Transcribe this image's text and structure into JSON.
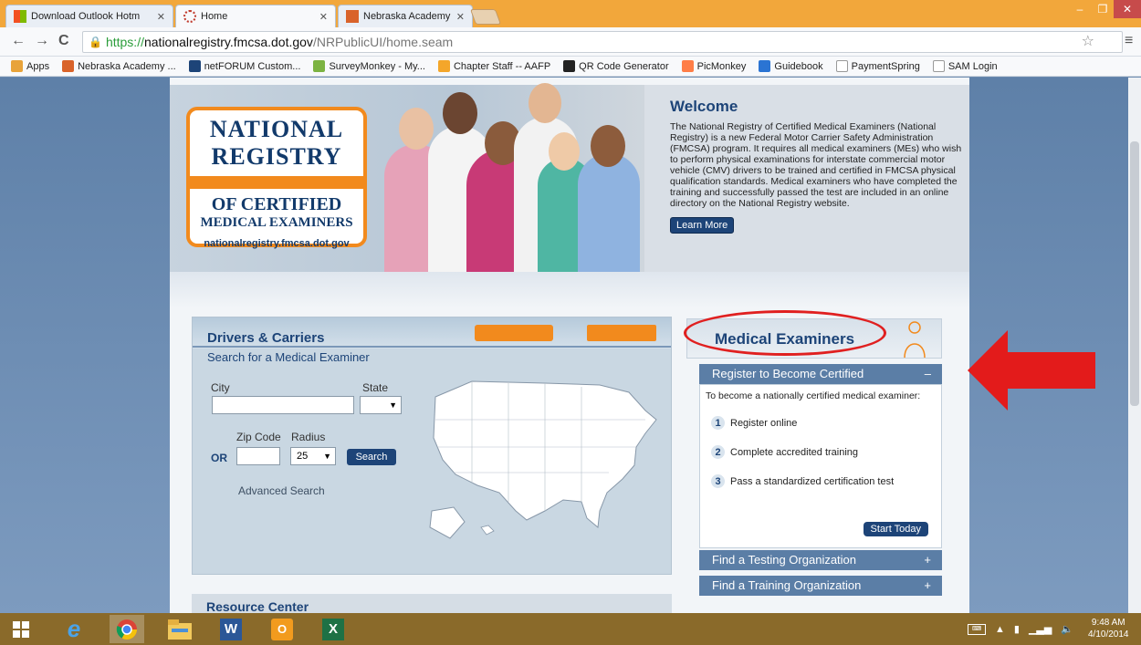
{
  "browser": {
    "tabs": [
      {
        "title": "Download Outlook Hotm",
        "active": false
      },
      {
        "title": "Home",
        "active": true
      },
      {
        "title": "Nebraska Academy of Far",
        "active": false
      }
    ],
    "window_controls": {
      "minimize": "–",
      "maximize": "❐",
      "close": "✕"
    },
    "address": {
      "scheme": "https://",
      "host": "nationalregistry.fmcsa.dot.gov",
      "path": "/NRPublicUI/home.seam"
    },
    "bookmarks": [
      {
        "label": "Apps",
        "icon": "apps-grid-icon",
        "color": "#e8a33a"
      },
      {
        "label": "Nebraska Academy ...",
        "icon": "nebraska-academy-icon",
        "color": "#d9632a"
      },
      {
        "label": "netFORUM Custom...",
        "icon": "netforum-icon",
        "color": "#1d4478"
      },
      {
        "label": "SurveyMonkey - My...",
        "icon": "surveymonkey-icon",
        "color": "#7cb342"
      },
      {
        "label": "Chapter Staff -- AAFP",
        "icon": "aafp-icon",
        "color": "#f4a62a"
      },
      {
        "label": "QR Code Generator",
        "icon": "qr-code-icon",
        "color": "#222222"
      },
      {
        "label": "PicMonkey",
        "icon": "picmonkey-icon",
        "color": "#ff7e47"
      },
      {
        "label": "Guidebook",
        "icon": "guidebook-icon",
        "color": "#2b74d3"
      },
      {
        "label": "PaymentSpring",
        "icon": "page-icon",
        "color": "#ffffff"
      },
      {
        "label": "SAM Login",
        "icon": "page-icon",
        "color": "#ffffff"
      }
    ]
  },
  "logo": {
    "line1": "NATIONAL",
    "line2": "REGISTRY",
    "line3": "OF CERTIFIED",
    "line4": "MEDICAL EXAMINERS",
    "url": "nationalregistry.fmcsa.dot.gov"
  },
  "welcome": {
    "title": "Welcome",
    "text": "The National Registry of Certified Medical Examiners (National Registry) is a new Federal Motor Carrier Safety Administration (FMCSA) program. It requires all medical examiners (MEs) who wish to perform physical examinations for interstate commercial motor vehicle (CMV) drivers to be trained and certified in FMCSA physical qualification standards. Medical examiners who have completed the training and successfully passed the test are included in an online directory on the National Registry website.",
    "button": "Learn More"
  },
  "drivers": {
    "title": "Drivers & Carriers",
    "subtitle": "Search for a Medical Examiner",
    "city_label": "City",
    "state_label": "State",
    "state_value": "",
    "zip_label": "Zip Code",
    "radius_label": "Radius",
    "or_label": "OR",
    "radius_value": "25",
    "search_button": "Search",
    "advanced_link": "Advanced Search"
  },
  "examiners": {
    "title": "Medical Examiners",
    "register_row": "Register to Become Certified",
    "register_toggle": "–",
    "intro": "To become a nationally certified medical examiner:",
    "steps": [
      {
        "num": "1",
        "text": "Register online"
      },
      {
        "num": "2",
        "text": "Complete accredited training"
      },
      {
        "num": "3",
        "text": "Pass a standardized certification test"
      }
    ],
    "start_button": "Start Today",
    "testing_row": "Find a Testing Organization",
    "training_row": "Find a Training Organization",
    "expand_toggle": "+"
  },
  "resource": {
    "title": "Resource Center"
  },
  "colors": {
    "accent_orange": "#f28a1d",
    "navy": "#1d4478",
    "highlight_red": "#e02020",
    "chrome_tabstrip": "#f2a73b"
  },
  "taskbar": {
    "apps": [
      {
        "name": "windows-start-icon"
      },
      {
        "name": "internet-explorer-icon"
      },
      {
        "name": "chrome-icon"
      },
      {
        "name": "file-explorer-icon"
      },
      {
        "name": "word-icon"
      },
      {
        "name": "outlook-icon"
      },
      {
        "name": "excel-icon"
      }
    ],
    "time": "9:48 AM",
    "date": "4/10/2014"
  }
}
